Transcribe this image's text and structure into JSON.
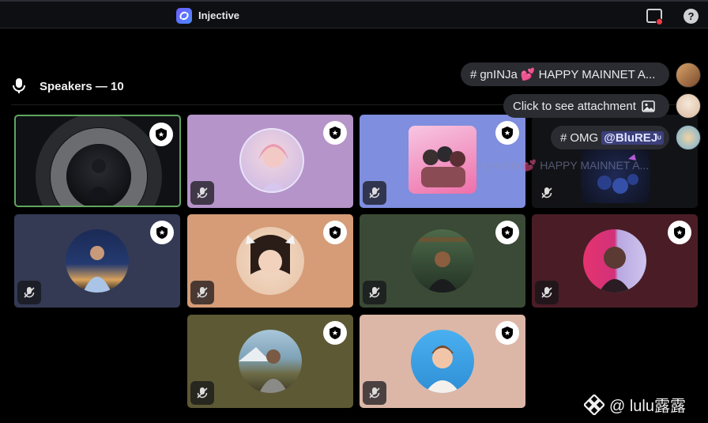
{
  "app": {
    "title": "Injective",
    "logo_icon": "injective-logo-icon"
  },
  "topbar": {
    "screen_icon": "screen-share-icon",
    "help_label": "?"
  },
  "stage": {
    "title": "Speakers — 10",
    "mic_icon": "microphone-icon"
  },
  "colors": {
    "active_border": "#5fa65f",
    "notification_dot": "#ef3b4a",
    "mention_bg": "#3b3f7a"
  },
  "tiles": [
    {
      "id": "speaker-1",
      "muted": false,
      "speaking": true,
      "bg": "#101114"
    },
    {
      "id": "speaker-2",
      "muted": true,
      "bg": "#b594c9"
    },
    {
      "id": "speaker-3",
      "muted": true,
      "bg": "#7f8ede"
    },
    {
      "id": "speaker-4",
      "muted": true,
      "bg": "#121316"
    },
    {
      "id": "speaker-5",
      "muted": true,
      "bg": "#343a54"
    },
    {
      "id": "speaker-6",
      "muted": true,
      "bg": "#d59c77"
    },
    {
      "id": "speaker-7",
      "muted": true,
      "bg": "#3a4a36"
    },
    {
      "id": "speaker-8",
      "muted": true,
      "bg": "#4a1d26"
    },
    {
      "id": "speaker-9",
      "muted": true,
      "bg": "#5c5934"
    },
    {
      "id": "speaker-10",
      "muted": true,
      "bg": "#dcb7a8"
    }
  ],
  "chat": {
    "messages": [
      {
        "prefix": "#",
        "text": "gnINJa",
        "emoji": "💕",
        "rest": "HAPPY MAINNET A..."
      },
      {
        "text": "Click to see attachment",
        "icon": "image-icon"
      },
      {
        "prefix": "#",
        "text": "OMG",
        "mention": "@BluREJ",
        "mention_suffix": "ᵁ"
      }
    ],
    "ghost_text": "# gnINJa 💕 HAPPY MAINNET A..."
  },
  "watermark": {
    "text": "@ lulu露露",
    "icon": "binance-logo-icon"
  }
}
